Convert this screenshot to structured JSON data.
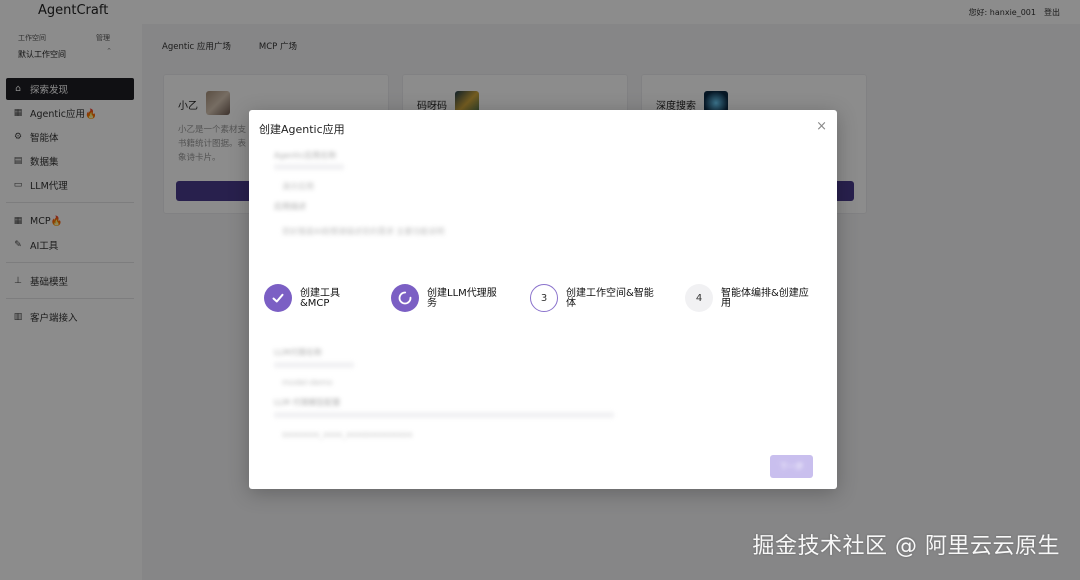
{
  "app": {
    "logo": "AgentCraft"
  },
  "user": {
    "greeting": "您好: hanxie_001",
    "logout": "登出"
  },
  "workspace": {
    "label": "工作空间",
    "switch": "管理",
    "name": "默认工作空间",
    "caret": "⌃"
  },
  "sidebar": {
    "items": [
      {
        "label": "探索发现",
        "icon": "home-icon",
        "glyph": "⌂"
      },
      {
        "label": "Agentic应用🔥",
        "icon": "apps-icon",
        "glyph": "▦"
      },
      {
        "label": "智能体",
        "icon": "agent-icon",
        "glyph": "⚙"
      },
      {
        "label": "数据集",
        "icon": "dataset-icon",
        "glyph": "▤"
      },
      {
        "label": "LLM代理",
        "icon": "proxy-icon",
        "glyph": "▭"
      },
      {
        "label": "MCP🔥",
        "icon": "mcp-icon",
        "glyph": "▦"
      },
      {
        "label": "AI工具",
        "icon": "tool-icon",
        "glyph": "✎"
      },
      {
        "label": "基础模型",
        "icon": "model-icon",
        "glyph": "⊥"
      },
      {
        "label": "客户端接入",
        "icon": "client-icon",
        "glyph": "▥"
      }
    ]
  },
  "tabs": [
    "Agentic 应用广场",
    "MCP 广场"
  ],
  "cards": [
    {
      "title": "小乙",
      "desc": "小乙是一个素材支\n书籍统计图据。表\n象诗卡片。"
    },
    {
      "title": "码呀码",
      "desc": ""
    },
    {
      "title": "深度搜索",
      "desc": ""
    }
  ],
  "modal": {
    "title": "创建Agentic应用",
    "close": "×",
    "blurred": {
      "field1_label": "Agentic应用名称",
      "field1_value": "演示应用",
      "field2_label": "应用描述",
      "field2_value": "您好我是AI助理请描述您的需求 主要功能说明",
      "field3_label": "LLM代理名称",
      "field3_value": "model-demo",
      "field4_label": "LLM 代理模型配置",
      "field4_value": "sxxxxxxx_xxxx_xxxxxxxxxxxxxx"
    },
    "steps": [
      {
        "label": "创建工具&MCP",
        "status": "done"
      },
      {
        "label": "创建LLM代理服务",
        "status": "processing"
      },
      {
        "label": "创建工作空间&智能体",
        "status": "wait",
        "num": "3"
      },
      {
        "label": "智能体编排&创建应用",
        "status": "wait",
        "num": "4"
      }
    ],
    "next_label": "下一步"
  },
  "watermark": "掘金技术社区 @ 阿里云云原生"
}
